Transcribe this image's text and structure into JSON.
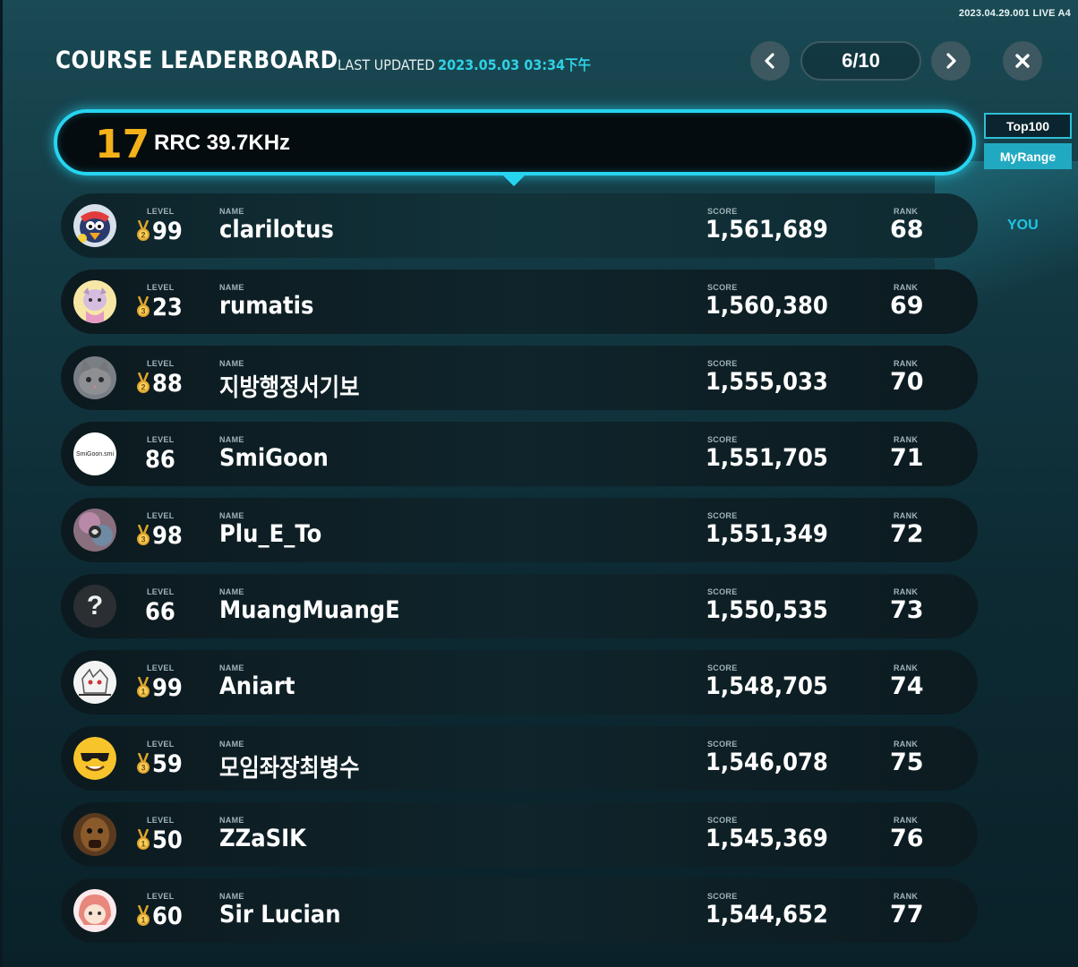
{
  "version": "2023.04.29.001 LIVE A4",
  "header": {
    "title": "COURSE LEADERBOARD",
    "last_updated_label": "LAST UPDATED",
    "last_updated_value": "2023.05.03 03:34下午",
    "page": "6/10",
    "prev_icon": "‹",
    "next_icon": "›",
    "close_icon": "✕"
  },
  "course": {
    "number": "17",
    "name": "RRC 39.7KHz"
  },
  "tabs": {
    "top100": "Top100",
    "myrange": "MyRange"
  },
  "you_label": "YOU",
  "labels": {
    "level": "LEVEL",
    "name": "NAME",
    "score": "SCORE",
    "rank": "RANK"
  },
  "entries": [
    {
      "level": "99",
      "name": "clarilotus",
      "score": "1,561,689",
      "rank": "68",
      "medal": "2",
      "avatar": "penguin-avatar",
      "is_me": true
    },
    {
      "level": "23",
      "name": "rumatis",
      "score": "1,560,380",
      "rank": "69",
      "medal": "3",
      "avatar": "anime-avatar"
    },
    {
      "level": "88",
      "name": "지방행정서기보",
      "score": "1,555,033",
      "rank": "70",
      "medal": "2",
      "avatar": "cat-avatar"
    },
    {
      "level": "86",
      "name": "SmiGoon",
      "score": "1,551,705",
      "rank": "71",
      "medal": "",
      "avatar": "text-avatar",
      "avatar_text": "SmiGoon.smi"
    },
    {
      "level": "98",
      "name": "Plu_E_To",
      "score": "1,551,349",
      "rank": "72",
      "medal": "3",
      "avatar": "planet-avatar"
    },
    {
      "level": "66",
      "name": "MuangMuangE",
      "score": "1,550,535",
      "rank": "73",
      "medal": "",
      "avatar": "unknown-avatar",
      "avatar_text": "?"
    },
    {
      "level": "99",
      "name": "Aniart",
      "score": "1,548,705",
      "rank": "74",
      "medal": "1",
      "avatar": "sketch-avatar"
    },
    {
      "level": "59",
      "name": "모임좌장최병수",
      "score": "1,546,078",
      "rank": "75",
      "medal": "3",
      "avatar": "sunglasses-avatar"
    },
    {
      "level": "50",
      "name": "ZZaSIK",
      "score": "1,545,369",
      "rank": "76",
      "medal": "1",
      "avatar": "monster-avatar"
    },
    {
      "level": "60",
      "name": "Sir Lucian",
      "score": "1,544,652",
      "rank": "77",
      "medal": "1",
      "avatar": "redhair-avatar"
    }
  ],
  "colors": {
    "accent": "#27d4f0",
    "course_number": "#f3b11a",
    "timestamp": "#2fd1e6",
    "medal_gold": "#e0a52a"
  }
}
